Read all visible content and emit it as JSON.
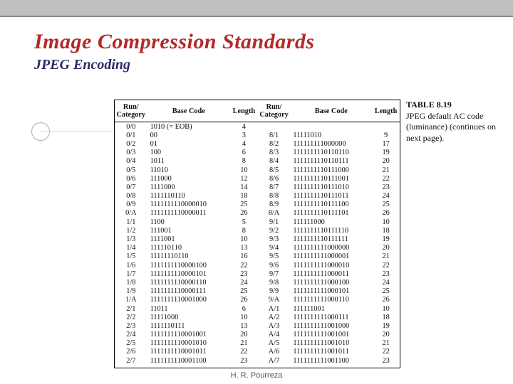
{
  "title": "Image Compression Standards",
  "subtitle": "JPEG Encoding",
  "caption": {
    "head": "TABLE 8.19",
    "body": "JPEG default AC code (luminance) (continues on next page)."
  },
  "headers": [
    "Run/\nCategory",
    "Base Code",
    "Length",
    "Run/\nCategory",
    "Base Code",
    "Length"
  ],
  "chart_data": {
    "type": "table",
    "title": "JPEG default AC code (luminance)",
    "columns": [
      "Run/Category",
      "Base Code",
      "Length"
    ],
    "rows": [
      [
        "0/0",
        "1010 (= EOB)",
        "4"
      ],
      [
        "0/1",
        "00",
        "3"
      ],
      [
        "0/2",
        "01",
        "4"
      ],
      [
        "0/3",
        "100",
        "6"
      ],
      [
        "0/4",
        "1011",
        "8"
      ],
      [
        "0/5",
        "11010",
        "10"
      ],
      [
        "0/6",
        "111000",
        "12"
      ],
      [
        "0/7",
        "1111000",
        "14"
      ],
      [
        "0/8",
        "1111110110",
        "18"
      ],
      [
        "0/9",
        "1111111110000010",
        "25"
      ],
      [
        "0/A",
        "1111111110000011",
        "26"
      ],
      [
        "1/1",
        "1100",
        "5"
      ],
      [
        "1/2",
        "111001",
        "8"
      ],
      [
        "1/3",
        "1111001",
        "10"
      ],
      [
        "1/4",
        "111110110",
        "13"
      ],
      [
        "1/5",
        "11111110110",
        "16"
      ],
      [
        "1/6",
        "1111111110000100",
        "22"
      ],
      [
        "1/7",
        "1111111110000101",
        "23"
      ],
      [
        "1/8",
        "1111111110000110",
        "24"
      ],
      [
        "1/9",
        "1111111110000111",
        "25"
      ],
      [
        "1/A",
        "1111111110001000",
        "26"
      ],
      [
        "2/1",
        "11011",
        "6"
      ],
      [
        "2/2",
        "11111000",
        "10"
      ],
      [
        "2/3",
        "1111110111",
        "13"
      ],
      [
        "2/4",
        "1111111110001001",
        "20"
      ],
      [
        "2/5",
        "1111111110001010",
        "21"
      ],
      [
        "2/6",
        "1111111110001011",
        "22"
      ],
      [
        "2/7",
        "1111111110001100",
        "23"
      ],
      [
        "8/1",
        "11111010",
        "9"
      ],
      [
        "8/2",
        "111111111000000",
        "17"
      ],
      [
        "8/3",
        "1111111110110110",
        "19"
      ],
      [
        "8/4",
        "1111111110110111",
        "20"
      ],
      [
        "8/5",
        "1111111110111000",
        "21"
      ],
      [
        "8/6",
        "1111111110111001",
        "22"
      ],
      [
        "8/7",
        "1111111110111010",
        "23"
      ],
      [
        "8/8",
        "1111111110111011",
        "24"
      ],
      [
        "8/9",
        "1111111110111100",
        "25"
      ],
      [
        "8/A",
        "1111111110111101",
        "26"
      ],
      [
        "9/1",
        "111111000",
        "10"
      ],
      [
        "9/2",
        "1111111110111110",
        "18"
      ],
      [
        "9/3",
        "1111111110111111",
        "19"
      ],
      [
        "9/4",
        "1111111111000000",
        "20"
      ],
      [
        "9/5",
        "1111111111000001",
        "21"
      ],
      [
        "9/6",
        "1111111111000010",
        "22"
      ],
      [
        "9/7",
        "1111111111000011",
        "23"
      ],
      [
        "9/8",
        "1111111111000100",
        "24"
      ],
      [
        "9/9",
        "1111111111000101",
        "25"
      ],
      [
        "9/A",
        "1111111111000110",
        "26"
      ],
      [
        "A/1",
        "111111001",
        "10"
      ],
      [
        "A/2",
        "1111111111000111",
        "18"
      ],
      [
        "A/3",
        "1111111111001000",
        "19"
      ],
      [
        "A/4",
        "1111111111001001",
        "20"
      ],
      [
        "A/5",
        "1111111111001010",
        "21"
      ],
      [
        "A/6",
        "1111111111001011",
        "22"
      ],
      [
        "A/7",
        "1111111111001100",
        "23"
      ]
    ]
  },
  "rows": [
    {
      "l": [
        "0/0",
        "1010 (= EOB)",
        "4"
      ],
      "r": [
        "",
        "",
        ""
      ]
    },
    {
      "l": [
        "0/1",
        "00",
        "3"
      ],
      "r": [
        "8/1",
        "11111010",
        "9"
      ]
    },
    {
      "l": [
        "0/2",
        "01",
        "4"
      ],
      "r": [
        "8/2",
        "111111111000000",
        "17"
      ]
    },
    {
      "l": [
        "0/3",
        "100",
        "6"
      ],
      "r": [
        "8/3",
        "1111111110110110",
        "19"
      ]
    },
    {
      "l": [
        "0/4",
        "1011",
        "8"
      ],
      "r": [
        "8/4",
        "1111111110110111",
        "20"
      ]
    },
    {
      "l": [
        "0/5",
        "11010",
        "10"
      ],
      "r": [
        "8/5",
        "1111111110111000",
        "21"
      ]
    },
    {
      "l": [
        "0/6",
        "111000",
        "12"
      ],
      "r": [
        "8/6",
        "1111111110111001",
        "22"
      ]
    },
    {
      "l": [
        "0/7",
        "1111000",
        "14"
      ],
      "r": [
        "8/7",
        "1111111110111010",
        "23"
      ]
    },
    {
      "l": [
        "0/8",
        "1111110110",
        "18"
      ],
      "r": [
        "8/8",
        "1111111110111011",
        "24"
      ]
    },
    {
      "l": [
        "0/9",
        "1111111110000010",
        "25"
      ],
      "r": [
        "8/9",
        "1111111110111100",
        "25"
      ]
    },
    {
      "l": [
        "0/A",
        "1111111110000011",
        "26"
      ],
      "r": [
        "8/A",
        "1111111110111101",
        "26"
      ]
    },
    {
      "l": [
        "1/1",
        "1100",
        "5"
      ],
      "r": [
        "9/1",
        "111111000",
        "10"
      ]
    },
    {
      "l": [
        "1/2",
        "111001",
        "8"
      ],
      "r": [
        "9/2",
        "1111111110111110",
        "18"
      ]
    },
    {
      "l": [
        "1/3",
        "1111001",
        "10"
      ],
      "r": [
        "9/3",
        "1111111110111111",
        "19"
      ]
    },
    {
      "l": [
        "1/4",
        "111110110",
        "13"
      ],
      "r": [
        "9/4",
        "1111111111000000",
        "20"
      ]
    },
    {
      "l": [
        "1/5",
        "11111110110",
        "16"
      ],
      "r": [
        "9/5",
        "1111111111000001",
        "21"
      ]
    },
    {
      "l": [
        "1/6",
        "1111111110000100",
        "22"
      ],
      "r": [
        "9/6",
        "1111111111000010",
        "22"
      ]
    },
    {
      "l": [
        "1/7",
        "1111111110000101",
        "23"
      ],
      "r": [
        "9/7",
        "1111111111000011",
        "23"
      ]
    },
    {
      "l": [
        "1/8",
        "1111111110000110",
        "24"
      ],
      "r": [
        "9/8",
        "1111111111000100",
        "24"
      ]
    },
    {
      "l": [
        "1/9",
        "1111111110000111",
        "25"
      ],
      "r": [
        "9/9",
        "1111111111000101",
        "25"
      ]
    },
    {
      "l": [
        "1/A",
        "1111111110001000",
        "26"
      ],
      "r": [
        "9/A",
        "1111111111000110",
        "26"
      ]
    },
    {
      "l": [
        "2/1",
        "11011",
        "6"
      ],
      "r": [
        "A/1",
        "111111001",
        "10"
      ]
    },
    {
      "l": [
        "2/2",
        "11111000",
        "10"
      ],
      "r": [
        "A/2",
        "1111111111000111",
        "18"
      ]
    },
    {
      "l": [
        "2/3",
        "1111110111",
        "13"
      ],
      "r": [
        "A/3",
        "1111111111001000",
        "19"
      ]
    },
    {
      "l": [
        "2/4",
        "1111111110001001",
        "20"
      ],
      "r": [
        "A/4",
        "1111111111001001",
        "20"
      ]
    },
    {
      "l": [
        "2/5",
        "1111111110001010",
        "21"
      ],
      "r": [
        "A/5",
        "1111111111001010",
        "21"
      ]
    },
    {
      "l": [
        "2/6",
        "1111111110001011",
        "22"
      ],
      "r": [
        "A/6",
        "1111111111001011",
        "22"
      ]
    },
    {
      "l": [
        "2/7",
        "1111111110001100",
        "23"
      ],
      "r": [
        "A/7",
        "1111111111001100",
        "23"
      ]
    }
  ],
  "footer": "H. R. Pourreza"
}
